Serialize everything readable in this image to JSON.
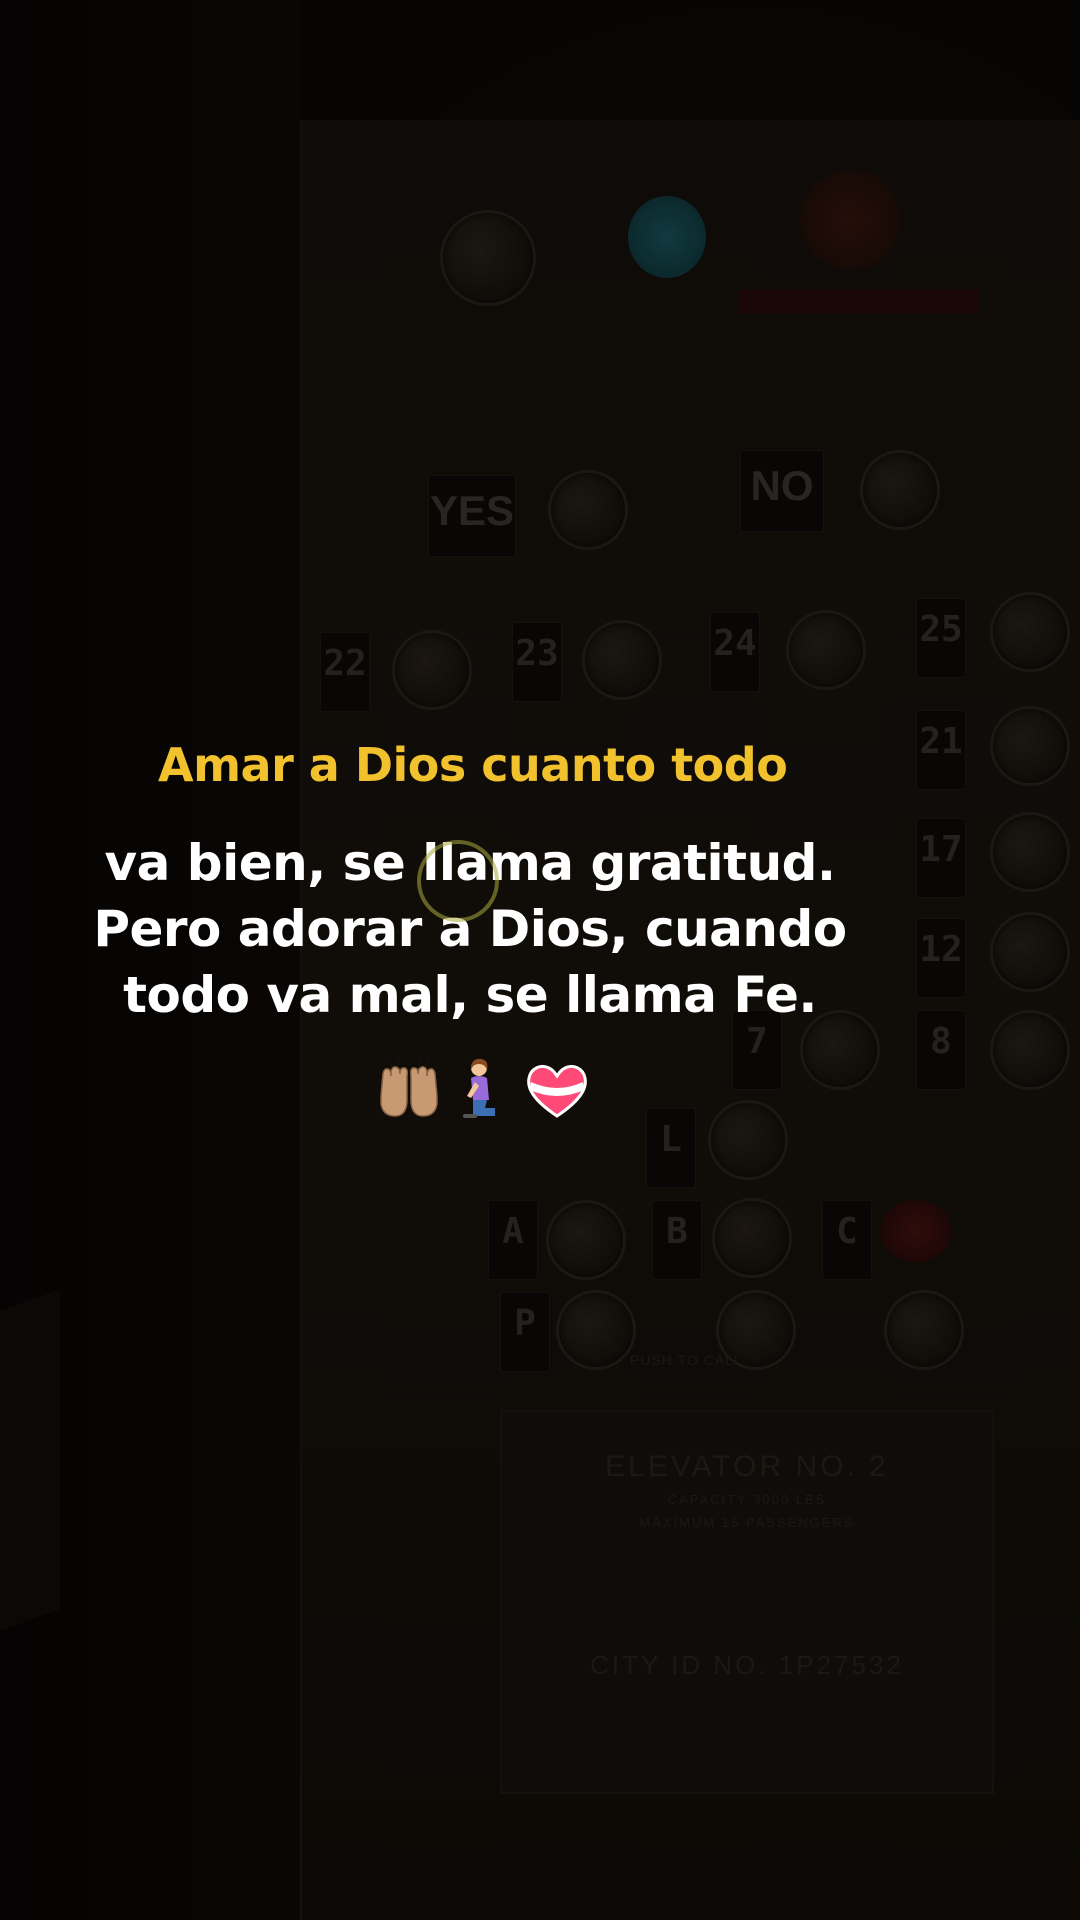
{
  "caption": {
    "line1": "Amar a Dios cuanto todo",
    "line2": "va bien, se llama gratitud.",
    "line3": "Pero adorar a Dios, cuando",
    "line4": "todo va mal, se llama Fe."
  },
  "emojis": [
    "raising-hands-icon",
    "woman-kneeling-icon",
    "mending-heart-icon"
  ],
  "background": {
    "signs": {
      "yes": "YES",
      "no": "NO"
    },
    "floor_tags": [
      "22",
      "23",
      "24",
      "25",
      "21",
      "17",
      "12",
      "7",
      "8",
      "L",
      "A",
      "B",
      "C",
      "P"
    ],
    "push_to_call": "PUSH TO CALL",
    "plate_title": "ELEVATOR NO. 2",
    "plate_capacity": "CAPACITY 3000 LBS",
    "plate_passengers": "MAXIMUM 15 PASSENGERS",
    "plate_city_id": "CITY ID NO. 1P27532"
  },
  "colors": {
    "caption_highlight": "#f2c12e",
    "caption_text": "#ffffff",
    "background": "#0b0806"
  }
}
